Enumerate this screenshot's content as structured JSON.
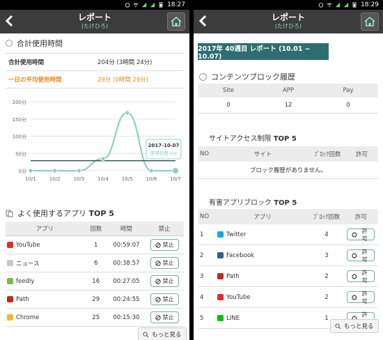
{
  "left": {
    "status_time": "18:27",
    "title": "レポート",
    "subtitle": "(たけひろ)",
    "total_section": "合計使用時間",
    "summary": [
      {
        "label": "合計使用時間",
        "value": "204分 (3時間 24分)"
      },
      {
        "label": "一日の平均使用時間",
        "value": "29分 (0時間 29分)"
      }
    ],
    "chart_data": {
      "type": "line",
      "categories": [
        "10/1",
        "10/2",
        "10/3",
        "10/4",
        "10/5",
        "10/6",
        "10/7"
      ],
      "values": [
        0,
        0,
        0,
        35,
        168,
        0,
        0
      ],
      "ylim": [
        0,
        200
      ],
      "yticks": [
        "200分",
        "150分",
        "100分",
        "50分",
        "0分"
      ],
      "ytick_values": [
        200,
        150,
        100,
        50,
        0
      ],
      "average": 29,
      "tooltip": {
        "date": "2017-10-07",
        "label": "使用時間 0分"
      },
      "line_color": "#8ecfc3",
      "avg_color": "#2b4a4a"
    },
    "apps_section": {
      "prefix": "よく使用するアプリ ",
      "bold": "TOP 5"
    },
    "apps_header": {
      "app": "アプリ",
      "count": "回数",
      "time": "時間",
      "block": "禁止"
    },
    "apps": [
      {
        "icon": "youtube-icon",
        "color": "#e52d27",
        "name": "YouTube",
        "count": "1",
        "time": "00:59:07",
        "button": "禁止"
      },
      {
        "icon": "news-icon",
        "color": "#c9c9c9",
        "name": "ニュース",
        "count": "6",
        "time": "00:38:57",
        "button": "禁止"
      },
      {
        "icon": "feedly-icon",
        "color": "#6cc04a",
        "name": "feedly",
        "count": "16",
        "time": "00:27:05",
        "button": "禁止"
      },
      {
        "icon": "path-icon",
        "color": "#c6281d",
        "name": "Path",
        "count": "29",
        "time": "00:24:55",
        "button": "禁止"
      },
      {
        "icon": "chrome-icon",
        "color": "#f2b824",
        "name": "Chrome",
        "count": "25",
        "time": "00:15:30",
        "button": "禁止"
      }
    ],
    "more_button": "もっと見る"
  },
  "right": {
    "status_time": "18:29",
    "title": "レポート",
    "subtitle": "(たけひろ)",
    "week_label": "2017年 40週目 レポート (10.01 ~ 10.07)",
    "content_block": {
      "title": "コンテンツブロック履歴",
      "headers": [
        "Site",
        "APP",
        "Pay"
      ],
      "values": [
        "0",
        "12",
        "0"
      ]
    },
    "site_access": {
      "title_prefix": "サイトアクセス制限 ",
      "title_bold": "TOP 5",
      "headers": [
        "NO",
        "サイト",
        "ﾌﾞﾛｯｸ回数",
        "許可"
      ],
      "empty": "ブロック履歴がありません。"
    },
    "harmful": {
      "title_prefix": "有害アプリブロック ",
      "title_bold": "TOP 5",
      "headers": [
        "NO",
        "アプリ",
        "ﾌﾞﾛｯｸ回数",
        "許可"
      ],
      "rows": [
        {
          "no": "1",
          "icon": "twitter-icon",
          "color": "#1da1f2",
          "name": "Twitter",
          "count": "4",
          "button": "許可"
        },
        {
          "no": "2",
          "icon": "facebook-icon",
          "color": "#3b5998",
          "name": "Facebook",
          "count": "3",
          "button": "許可"
        },
        {
          "no": "3",
          "icon": "path-icon",
          "color": "#c6281d",
          "name": "Path",
          "count": "2",
          "button": "許可"
        },
        {
          "no": "4",
          "icon": "youtube-icon",
          "color": "#e52d27",
          "name": "YouTube",
          "count": "2",
          "button": "許可"
        },
        {
          "no": "5",
          "icon": "line-icon",
          "color": "#00c300",
          "name": "LINE",
          "count": "1",
          "button": "許可"
        }
      ]
    },
    "more_button": "もっと見る"
  }
}
